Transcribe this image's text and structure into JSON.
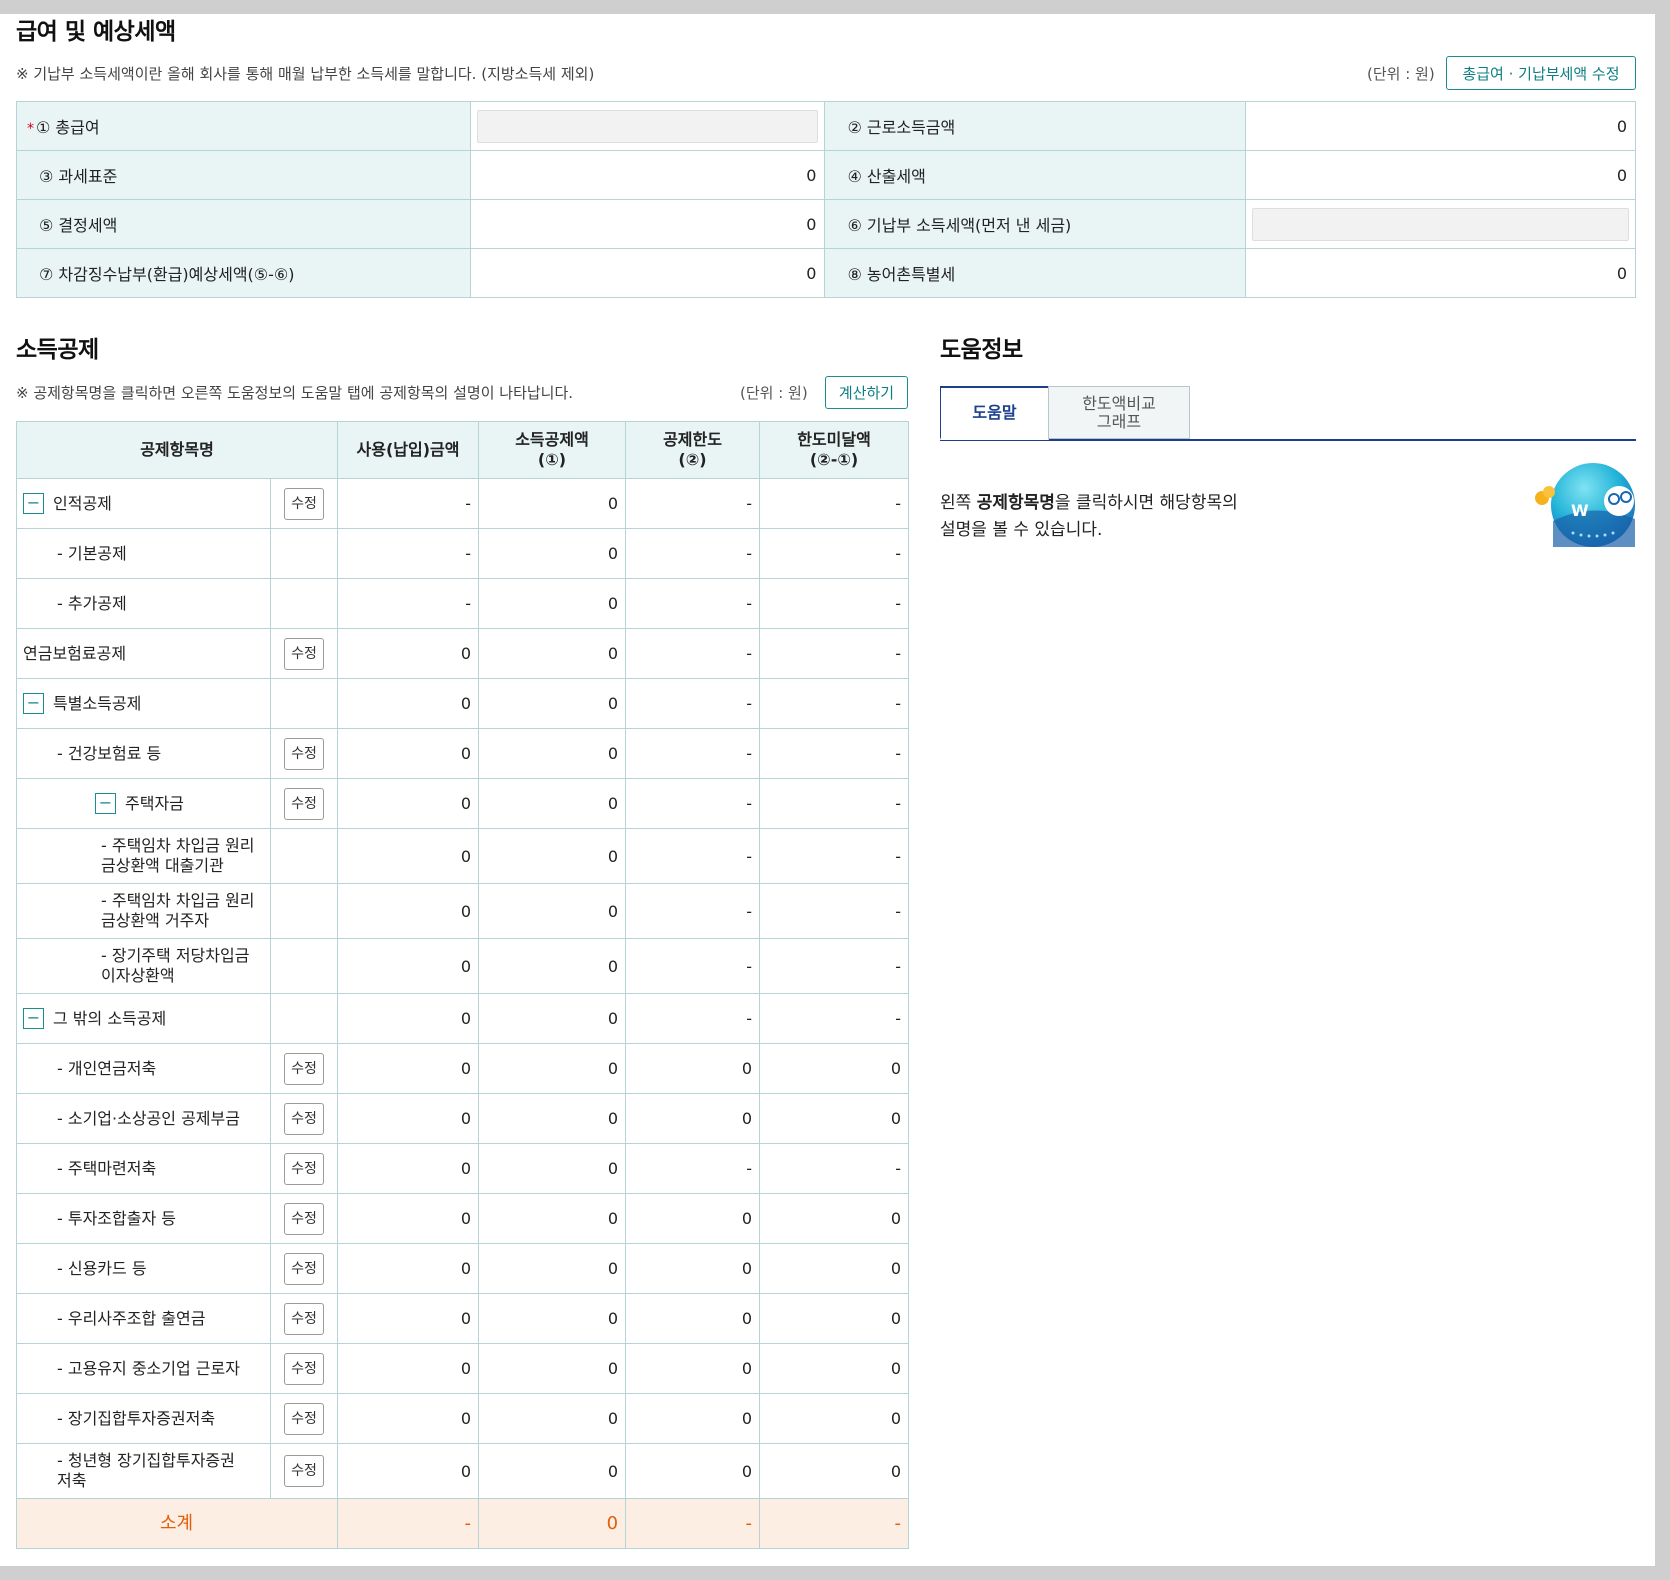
{
  "salary": {
    "title": "급여 및 예상세액",
    "note": "※ 기납부 소득세액이란 올해 회사를 통해 매월 납부한 소득세를 말합니다. (지방소득세 제외)",
    "unit": "(단위 : 원)",
    "edit_button": "총급여 · 기납부세액 수정",
    "required_mark": "*",
    "rows": [
      {
        "l1": "① 총급여",
        "v1": "",
        "l2": "② 근로소득금액",
        "v2": "0"
      },
      {
        "l1": "③ 과세표준",
        "v1": "0",
        "l2": "④ 산출세액",
        "v2": "0"
      },
      {
        "l1": "⑤ 결정세액",
        "v1": "0",
        "l2": "⑥ 기납부 소득세액(먼저 낸 세금)",
        "v2": ""
      },
      {
        "l1": "⑦ 차감징수납부(환급)예상세액(⑤-⑥)",
        "v1": "0",
        "l2": "⑧ 농어촌특별세",
        "v2": "0"
      }
    ]
  },
  "deduction": {
    "title": "소득공제",
    "note": "※ 공제항목명을 클릭하면 오른쪽 도움정보의 도움말 탭에 공제항목의 설명이 나타납니다.",
    "unit": "(단위 : 원)",
    "calc_button": "계산하기",
    "edit_label": "수정",
    "toggle_symbol": "−",
    "headers": [
      "공제항목명",
      "사용(납입)금액",
      "소득공제액\n(①)",
      "공제한도\n(②)",
      "한도미달액\n(②-①)"
    ],
    "rows": [
      {
        "name": "인적공제",
        "level": 0,
        "toggle": true,
        "edit": true,
        "used": "-",
        "ded": "0",
        "limit": "-",
        "rest": "-"
      },
      {
        "name": "- 기본공제",
        "level": 1,
        "toggle": false,
        "edit": false,
        "used": "-",
        "ded": "0",
        "limit": "-",
        "rest": "-"
      },
      {
        "name": "- 추가공제",
        "level": 1,
        "toggle": false,
        "edit": false,
        "used": "-",
        "ded": "0",
        "limit": "-",
        "rest": "-"
      },
      {
        "name": "연금보험료공제",
        "level": 0,
        "toggle": false,
        "edit": true,
        "used": "0",
        "ded": "0",
        "limit": "-",
        "rest": "-"
      },
      {
        "name": "특별소득공제",
        "level": 0,
        "toggle": true,
        "edit": false,
        "used": "0",
        "ded": "0",
        "limit": "-",
        "rest": "-"
      },
      {
        "name": "- 건강보험료 등",
        "level": 1,
        "toggle": false,
        "edit": true,
        "used": "0",
        "ded": "0",
        "limit": "-",
        "rest": "-"
      },
      {
        "name": "주택자금",
        "level": 2,
        "toggle": true,
        "edit": true,
        "used": "0",
        "ded": "0",
        "limit": "-",
        "rest": "-"
      },
      {
        "name": "- 주택임차 차입금 원리\n금상환액 대출기관",
        "level": 3,
        "toggle": false,
        "edit": false,
        "used": "0",
        "ded": "0",
        "limit": "-",
        "rest": "-"
      },
      {
        "name": "- 주택임차 차입금 원리\n금상환액 거주자",
        "level": 3,
        "toggle": false,
        "edit": false,
        "used": "0",
        "ded": "0",
        "limit": "-",
        "rest": "-"
      },
      {
        "name": "- 장기주택 저당차입금\n이자상환액",
        "level": 3,
        "toggle": false,
        "edit": false,
        "used": "0",
        "ded": "0",
        "limit": "-",
        "rest": "-"
      },
      {
        "name": "그 밖의 소득공제",
        "level": 0,
        "toggle": true,
        "edit": false,
        "used": "0",
        "ded": "0",
        "limit": "-",
        "rest": "-"
      },
      {
        "name": "- 개인연금저축",
        "level": 1,
        "toggle": false,
        "edit": true,
        "used": "0",
        "ded": "0",
        "limit": "0",
        "rest": "0"
      },
      {
        "name": "- 소기업·소상공인 공제부금",
        "level": 1,
        "toggle": false,
        "edit": true,
        "used": "0",
        "ded": "0",
        "limit": "0",
        "rest": "0"
      },
      {
        "name": "- 주택마련저축",
        "level": 1,
        "toggle": false,
        "edit": true,
        "used": "0",
        "ded": "0",
        "limit": "-",
        "rest": "-"
      },
      {
        "name": "- 투자조합출자 등",
        "level": 1,
        "toggle": false,
        "edit": true,
        "used": "0",
        "ded": "0",
        "limit": "0",
        "rest": "0"
      },
      {
        "name": "- 신용카드 등",
        "level": 1,
        "toggle": false,
        "edit": true,
        "used": "0",
        "ded": "0",
        "limit": "0",
        "rest": "0"
      },
      {
        "name": "- 우리사주조합 출연금",
        "level": 1,
        "toggle": false,
        "edit": true,
        "used": "0",
        "ded": "0",
        "limit": "0",
        "rest": "0"
      },
      {
        "name": "- 고용유지 중소기업 근로자",
        "level": 1,
        "toggle": false,
        "edit": true,
        "used": "0",
        "ded": "0",
        "limit": "0",
        "rest": "0"
      },
      {
        "name": "- 장기집합투자증권저축",
        "level": 1,
        "toggle": false,
        "edit": true,
        "used": "0",
        "ded": "0",
        "limit": "0",
        "rest": "0"
      },
      {
        "name": "- 청년형 장기집합투자증권\n저축",
        "level": 1,
        "toggle": false,
        "edit": true,
        "used": "0",
        "ded": "0",
        "limit": "0",
        "rest": "0"
      }
    ],
    "total": {
      "name": "소계",
      "used": "-",
      "ded": "0",
      "limit": "-",
      "rest": "-"
    }
  },
  "help": {
    "title": "도움정보",
    "tab_help": "도움말",
    "tab_graph": "한도액비교\n그래프",
    "text_before": "왼쪽 ",
    "text_bold": "공제항목명",
    "text_after": "을 클릭하시면 해당항목의",
    "text_line2": "설명을 볼 수 있습니다.",
    "mascot_icon": "mascot-icon",
    "mascot_letter": "W"
  },
  "colors": {
    "accent": "#1a8e8e",
    "header_bg": "#e9f4f4",
    "total_bg": "#fdeee3",
    "total_text": "#e35d0a",
    "tab_active": "#1b3f8b"
  }
}
